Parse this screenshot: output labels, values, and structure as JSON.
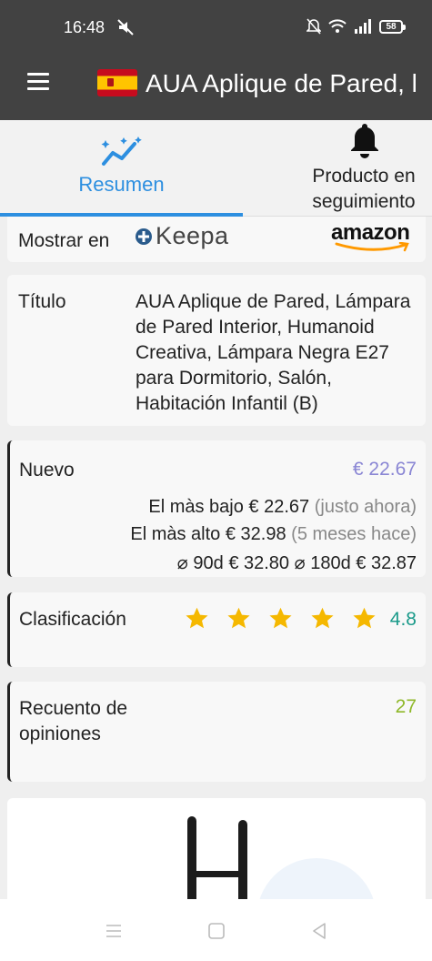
{
  "status_bar": {
    "time": "16:48",
    "battery": "58"
  },
  "app_bar": {
    "title": "AUA Aplique de Pared, l"
  },
  "tabs": [
    {
      "label": "Resumen",
      "active": true
    },
    {
      "label": "Producto en seguimiento",
      "active": false
    }
  ],
  "mostrar": {
    "label": "Mostrar en",
    "keepa": "Keepa",
    "amazon": "amazon"
  },
  "titulo": {
    "label": "Título",
    "value": "AUA Aplique de Pared, Lámpara de Pared Interior, Humanoid Creativa, Lámpara Negra E27 para Dormitorio, Salón, Habitación Infantil (B)"
  },
  "nuevo": {
    "label": "Nuevo",
    "price": "€ 22.67",
    "lowest_label": "El màs bajo",
    "lowest_price": "€ 22.67",
    "lowest_when": "(justo ahora)",
    "highest_label": "El màs alto",
    "highest_price": "€ 32.98",
    "highest_when": "(5 meses hace)",
    "avg90_label": "⌀ 90d",
    "avg90_price": "€ 32.80",
    "avg180_label": "⌀ 180d",
    "avg180_price": "€ 32.87"
  },
  "clasificacion": {
    "label": "Clasificación",
    "rating": "4.8",
    "stars": 5
  },
  "recuento": {
    "label": "Recuento de opiniones",
    "value": "27"
  },
  "colors": {
    "bar": "#424242",
    "accent_blue": "#2d8fe0",
    "nuevo": "#8a86d4",
    "clasificacion": "#1a9a8a",
    "recuento": "#9ac32a",
    "star": "#f5b800"
  }
}
